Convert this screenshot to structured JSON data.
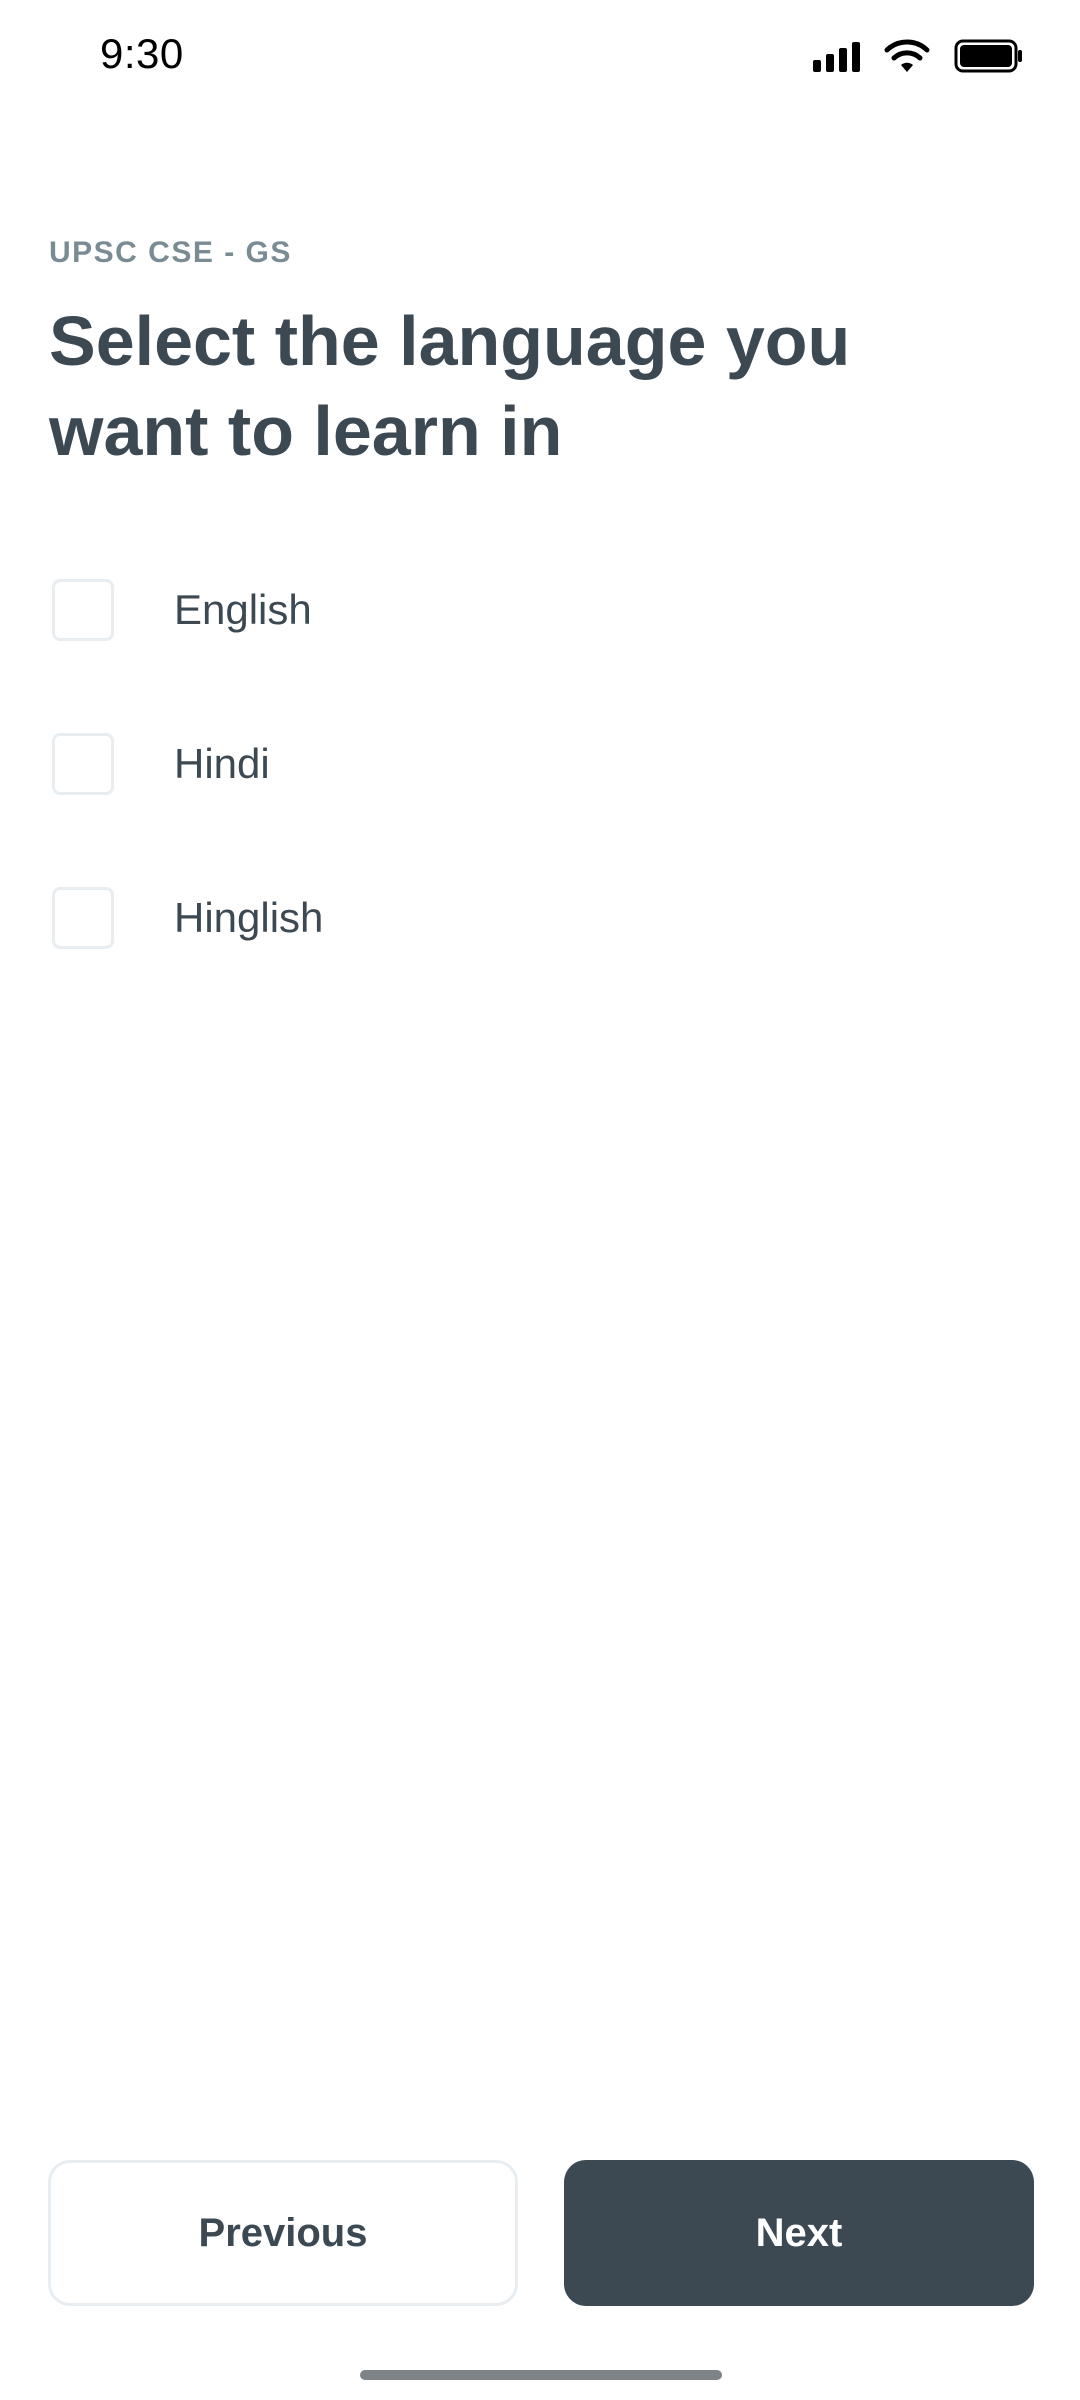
{
  "status_bar": {
    "time": "9:30",
    "icons": [
      "signal-icon",
      "wifi-icon",
      "battery-icon"
    ]
  },
  "header": {
    "course_label": "UPSC CSE - GS",
    "title": "Select the language you want to learn in"
  },
  "language_options": [
    {
      "label": "English",
      "checked": false
    },
    {
      "label": "Hindi",
      "checked": false
    },
    {
      "label": "Hinglish",
      "checked": false
    }
  ],
  "footer": {
    "previous_label": "Previous",
    "next_label": "Next"
  },
  "colors": {
    "primary": "#3c4852",
    "muted": "#7a8b94",
    "border": "#e7edf0",
    "background": "#ffffff"
  }
}
